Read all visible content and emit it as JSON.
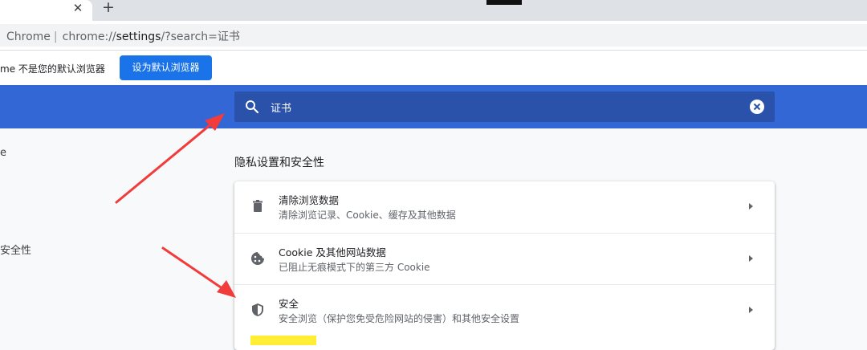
{
  "browser": {
    "tab_close_glyph": "✕",
    "new_tab_glyph": "+",
    "url_app": "Chrome",
    "url_prefix": "chrome://",
    "url_host": "settings",
    "url_rest": "/?search=证书"
  },
  "infobar": {
    "message": "me 不是您的默认浏览器",
    "button_label": "设为默认浏览器"
  },
  "settings": {
    "search_value": "证书",
    "nav_partial_1": "e",
    "nav_partial_2": "安全性",
    "section_title": "隐私设置和安全性",
    "rows": [
      {
        "title": "清除浏览数据",
        "subtitle": "清除浏览记录、Cookie、缓存及其他数据",
        "icon": "trash-icon"
      },
      {
        "title": "Cookie 及其他网站数据",
        "subtitle": "已阻止无痕模式下的第三方 Cookie",
        "icon": "cookie-icon"
      },
      {
        "title": "安全",
        "subtitle": "安全浏览（保护您免受危险网站的侵害）和其他安全设置",
        "icon": "shield-icon"
      }
    ]
  },
  "colors": {
    "header_blue": "#3367d6",
    "search_bg": "#2a52ab",
    "button_blue": "#1a73e8",
    "annotation_red": "#f23b3b",
    "highlight_yellow": "#ffee33"
  }
}
